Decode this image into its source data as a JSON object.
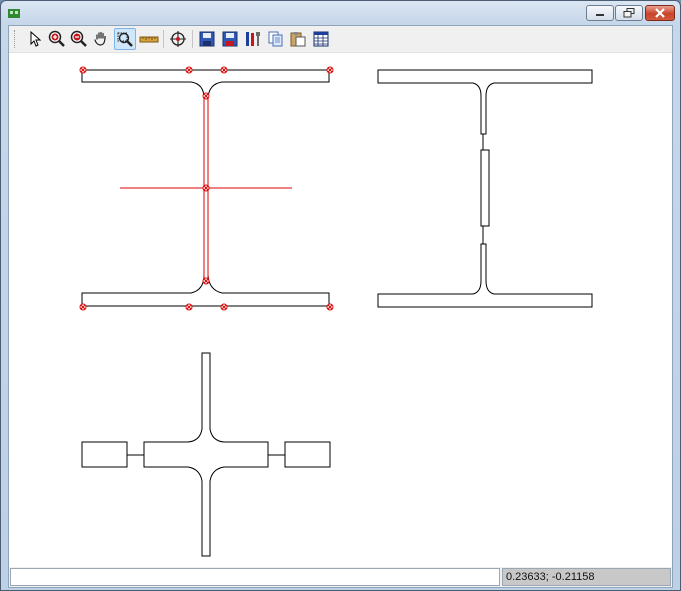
{
  "window": {
    "title": "",
    "controls": {
      "minimize": "minimize",
      "restore": "restore",
      "close": "close"
    }
  },
  "toolbar": {
    "tools": [
      {
        "name": "select-tool",
        "icon": "arrow-cursor-icon"
      },
      {
        "name": "zoom-in-tool",
        "icon": "zoom-in-icon"
      },
      {
        "name": "zoom-out-tool",
        "icon": "zoom-out-icon"
      },
      {
        "name": "pan-tool",
        "icon": "hand-icon"
      },
      {
        "name": "zoom-window-tool",
        "icon": "zoom-window-icon",
        "active": true
      },
      {
        "name": "measure-tool",
        "icon": "ruler-icon"
      },
      {
        "name": "zoom-extents-tool",
        "icon": "crosshair-icon"
      },
      {
        "name": "save-tool",
        "icon": "floppy-icon"
      },
      {
        "name": "save-as-tool",
        "icon": "floppy-red-icon"
      },
      {
        "name": "properties-tool",
        "icon": "tools-icon"
      },
      {
        "name": "copy-tool",
        "icon": "copy-icon"
      },
      {
        "name": "paste-tool",
        "icon": "paste-icon"
      },
      {
        "name": "table-tool",
        "icon": "table-icon"
      }
    ]
  },
  "status": {
    "message": "",
    "coordinates": "0.23633; -0.21158"
  },
  "colors": {
    "selection": "#dd0000",
    "outline": "#000000",
    "active_tool_bg": "#cfe6fb"
  }
}
